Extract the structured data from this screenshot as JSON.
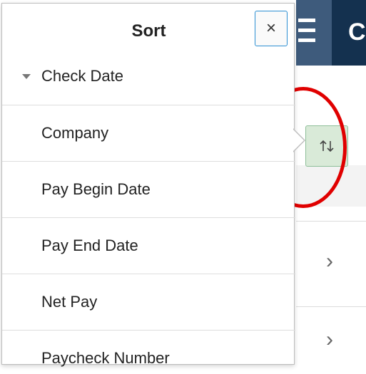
{
  "popup": {
    "title": "Sort",
    "close_label": "×",
    "items": [
      {
        "label": "Check Date",
        "active": true,
        "direction_icon": "triangle-down-icon"
      },
      {
        "label": "Company"
      },
      {
        "label": "Pay Begin Date"
      },
      {
        "label": "Pay End Date"
      },
      {
        "label": "Net Pay"
      },
      {
        "label": "Paycheck Number"
      }
    ]
  },
  "background": {
    "header_glyph": "C",
    "row_chevron": "›",
    "sort_button_icon": "sort-up-down-icon"
  },
  "colors": {
    "header_bg": "#14314f",
    "close_border": "#2b8ed2",
    "sort_button_bg": "#d9ead8",
    "highlight": "#e00000"
  }
}
